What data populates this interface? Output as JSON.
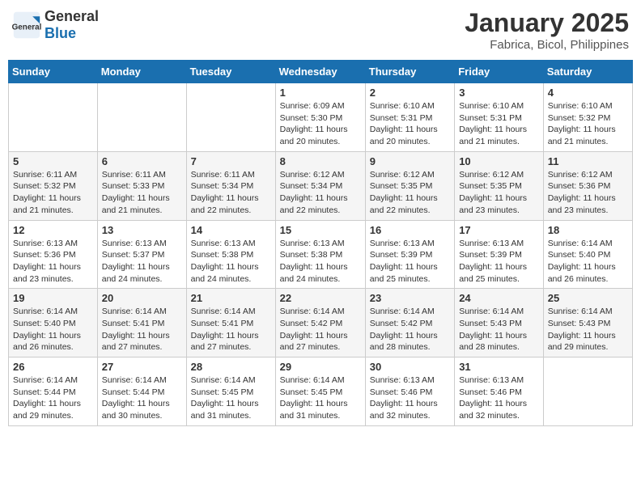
{
  "header": {
    "logo_general": "General",
    "logo_blue": "Blue",
    "month_title": "January 2025",
    "location": "Fabrica, Bicol, Philippines"
  },
  "weekdays": [
    "Sunday",
    "Monday",
    "Tuesday",
    "Wednesday",
    "Thursday",
    "Friday",
    "Saturday"
  ],
  "weeks": [
    [
      {
        "day": "",
        "info": ""
      },
      {
        "day": "",
        "info": ""
      },
      {
        "day": "",
        "info": ""
      },
      {
        "day": "1",
        "info": "Sunrise: 6:09 AM\nSunset: 5:30 PM\nDaylight: 11 hours and 20 minutes."
      },
      {
        "day": "2",
        "info": "Sunrise: 6:10 AM\nSunset: 5:31 PM\nDaylight: 11 hours and 20 minutes."
      },
      {
        "day": "3",
        "info": "Sunrise: 6:10 AM\nSunset: 5:31 PM\nDaylight: 11 hours and 21 minutes."
      },
      {
        "day": "4",
        "info": "Sunrise: 6:10 AM\nSunset: 5:32 PM\nDaylight: 11 hours and 21 minutes."
      }
    ],
    [
      {
        "day": "5",
        "info": "Sunrise: 6:11 AM\nSunset: 5:32 PM\nDaylight: 11 hours and 21 minutes."
      },
      {
        "day": "6",
        "info": "Sunrise: 6:11 AM\nSunset: 5:33 PM\nDaylight: 11 hours and 21 minutes."
      },
      {
        "day": "7",
        "info": "Sunrise: 6:11 AM\nSunset: 5:34 PM\nDaylight: 11 hours and 22 minutes."
      },
      {
        "day": "8",
        "info": "Sunrise: 6:12 AM\nSunset: 5:34 PM\nDaylight: 11 hours and 22 minutes."
      },
      {
        "day": "9",
        "info": "Sunrise: 6:12 AM\nSunset: 5:35 PM\nDaylight: 11 hours and 22 minutes."
      },
      {
        "day": "10",
        "info": "Sunrise: 6:12 AM\nSunset: 5:35 PM\nDaylight: 11 hours and 23 minutes."
      },
      {
        "day": "11",
        "info": "Sunrise: 6:12 AM\nSunset: 5:36 PM\nDaylight: 11 hours and 23 minutes."
      }
    ],
    [
      {
        "day": "12",
        "info": "Sunrise: 6:13 AM\nSunset: 5:36 PM\nDaylight: 11 hours and 23 minutes."
      },
      {
        "day": "13",
        "info": "Sunrise: 6:13 AM\nSunset: 5:37 PM\nDaylight: 11 hours and 24 minutes."
      },
      {
        "day": "14",
        "info": "Sunrise: 6:13 AM\nSunset: 5:38 PM\nDaylight: 11 hours and 24 minutes."
      },
      {
        "day": "15",
        "info": "Sunrise: 6:13 AM\nSunset: 5:38 PM\nDaylight: 11 hours and 24 minutes."
      },
      {
        "day": "16",
        "info": "Sunrise: 6:13 AM\nSunset: 5:39 PM\nDaylight: 11 hours and 25 minutes."
      },
      {
        "day": "17",
        "info": "Sunrise: 6:13 AM\nSunset: 5:39 PM\nDaylight: 11 hours and 25 minutes."
      },
      {
        "day": "18",
        "info": "Sunrise: 6:14 AM\nSunset: 5:40 PM\nDaylight: 11 hours and 26 minutes."
      }
    ],
    [
      {
        "day": "19",
        "info": "Sunrise: 6:14 AM\nSunset: 5:40 PM\nDaylight: 11 hours and 26 minutes."
      },
      {
        "day": "20",
        "info": "Sunrise: 6:14 AM\nSunset: 5:41 PM\nDaylight: 11 hours and 27 minutes."
      },
      {
        "day": "21",
        "info": "Sunrise: 6:14 AM\nSunset: 5:41 PM\nDaylight: 11 hours and 27 minutes."
      },
      {
        "day": "22",
        "info": "Sunrise: 6:14 AM\nSunset: 5:42 PM\nDaylight: 11 hours and 27 minutes."
      },
      {
        "day": "23",
        "info": "Sunrise: 6:14 AM\nSunset: 5:42 PM\nDaylight: 11 hours and 28 minutes."
      },
      {
        "day": "24",
        "info": "Sunrise: 6:14 AM\nSunset: 5:43 PM\nDaylight: 11 hours and 28 minutes."
      },
      {
        "day": "25",
        "info": "Sunrise: 6:14 AM\nSunset: 5:43 PM\nDaylight: 11 hours and 29 minutes."
      }
    ],
    [
      {
        "day": "26",
        "info": "Sunrise: 6:14 AM\nSunset: 5:44 PM\nDaylight: 11 hours and 29 minutes."
      },
      {
        "day": "27",
        "info": "Sunrise: 6:14 AM\nSunset: 5:44 PM\nDaylight: 11 hours and 30 minutes."
      },
      {
        "day": "28",
        "info": "Sunrise: 6:14 AM\nSunset: 5:45 PM\nDaylight: 11 hours and 31 minutes."
      },
      {
        "day": "29",
        "info": "Sunrise: 6:14 AM\nSunset: 5:45 PM\nDaylight: 11 hours and 31 minutes."
      },
      {
        "day": "30",
        "info": "Sunrise: 6:13 AM\nSunset: 5:46 PM\nDaylight: 11 hours and 32 minutes."
      },
      {
        "day": "31",
        "info": "Sunrise: 6:13 AM\nSunset: 5:46 PM\nDaylight: 11 hours and 32 minutes."
      },
      {
        "day": "",
        "info": ""
      }
    ]
  ]
}
